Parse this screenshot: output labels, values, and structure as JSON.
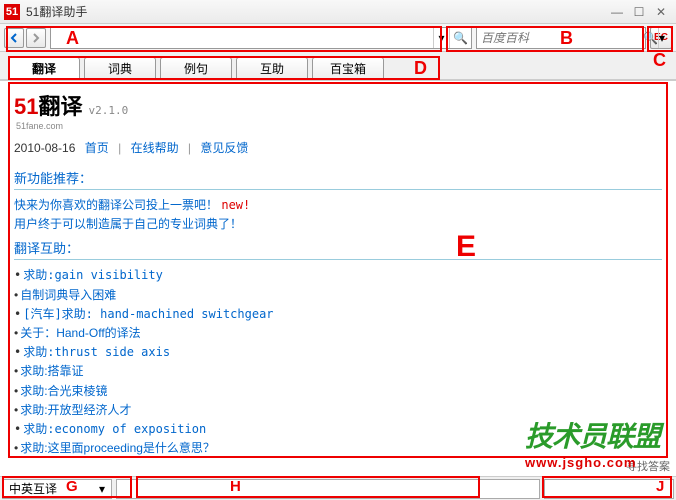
{
  "window": {
    "title": "51翻译助手"
  },
  "toolbar": {
    "main_search": "",
    "side_placeholder": "百度百科"
  },
  "labels": {
    "A": "A",
    "B": "B",
    "C": "C",
    "D": "D",
    "E": "E",
    "G": "G",
    "H": "H",
    "J": "J"
  },
  "tabs": [
    "翻译",
    "词典",
    "例句",
    "互助",
    "百宝箱"
  ],
  "brand": {
    "name_pre": "51",
    "name_main": "翻译",
    "sub": "51fane.com",
    "version": "v2.1.0"
  },
  "meta": {
    "date": "2010-08-16",
    "links": [
      "首页",
      "在线帮助",
      "意见反馈"
    ]
  },
  "sections": {
    "news_title": "新功能推荐：",
    "news_lines": [
      {
        "text": "快来为你喜欢的翻译公司投上一票吧！",
        "tag": "new!"
      },
      {
        "text": "用户终于可以制造属于自己的专业词典了！",
        "tag": ""
      }
    ],
    "help_title": "翻译互助：",
    "help_items": [
      "求助:gain visibility",
      "自制词典导入困难",
      "[汽车]求助: hand-machined switchgear",
      "关于：Hand-Off的译法",
      "求助:thrust side axis",
      "求助:搭靠证",
      "求助:合光束棱镜",
      "求助:开放型经济人才",
      "求助:economy of exposition",
      "求助:这里面proceeding是什么意思？"
    ]
  },
  "status": {
    "mode": "中英互译",
    "hint": "寻找答案"
  },
  "watermark": {
    "text": "技术员联盟",
    "url": "www.jsgho.com"
  }
}
